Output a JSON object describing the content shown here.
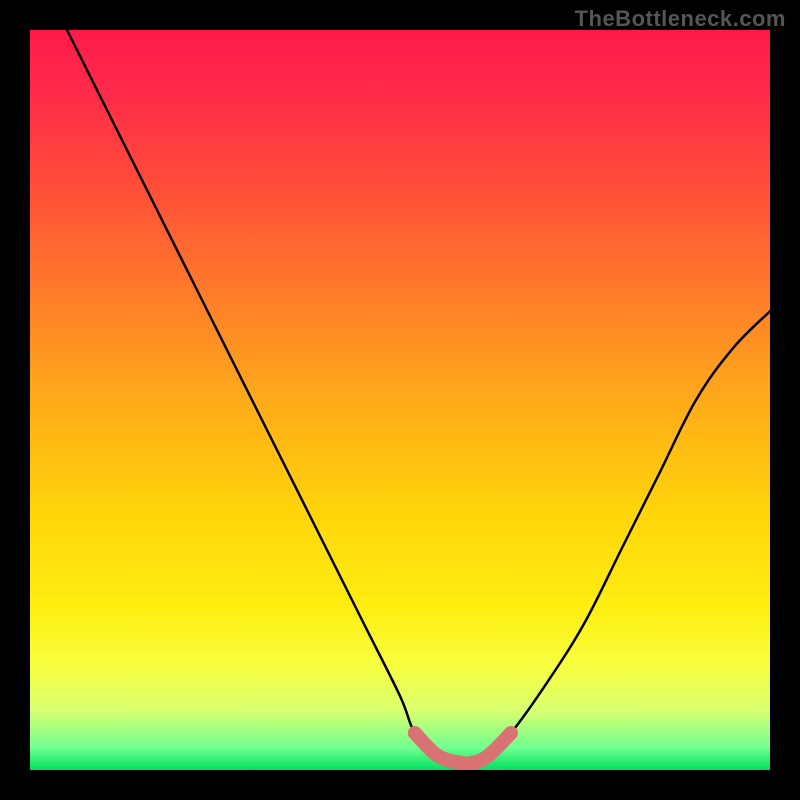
{
  "watermark": "TheBottleneck.com",
  "colors": {
    "gradient_top": "#ff1a4a",
    "gradient_bottom": "#00e060",
    "curve": "#000000",
    "marker": "#d97272",
    "frame": "#000000"
  },
  "chart_data": {
    "type": "line",
    "title": "",
    "xlabel": "",
    "ylabel": "",
    "xlim": [
      0,
      100
    ],
    "ylim": [
      0,
      100
    ],
    "legend": false,
    "grid": false,
    "series": [
      {
        "name": "bottleneck-curve",
        "x": [
          5,
          10,
          15,
          20,
          25,
          30,
          35,
          40,
          45,
          50,
          52,
          55,
          58,
          60,
          62,
          65,
          70,
          75,
          80,
          85,
          90,
          95,
          100
        ],
        "y": [
          100,
          90,
          80,
          70,
          60,
          50,
          40,
          30,
          20,
          10,
          5,
          2,
          1,
          1,
          2,
          5,
          12,
          20,
          30,
          40,
          50,
          57,
          62
        ]
      }
    ],
    "optimal_range": {
      "x": [
        52,
        55,
        58,
        60,
        62,
        65
      ],
      "y": [
        5,
        2,
        1,
        1,
        2,
        5
      ],
      "color": "#d97272"
    },
    "annotations": []
  }
}
